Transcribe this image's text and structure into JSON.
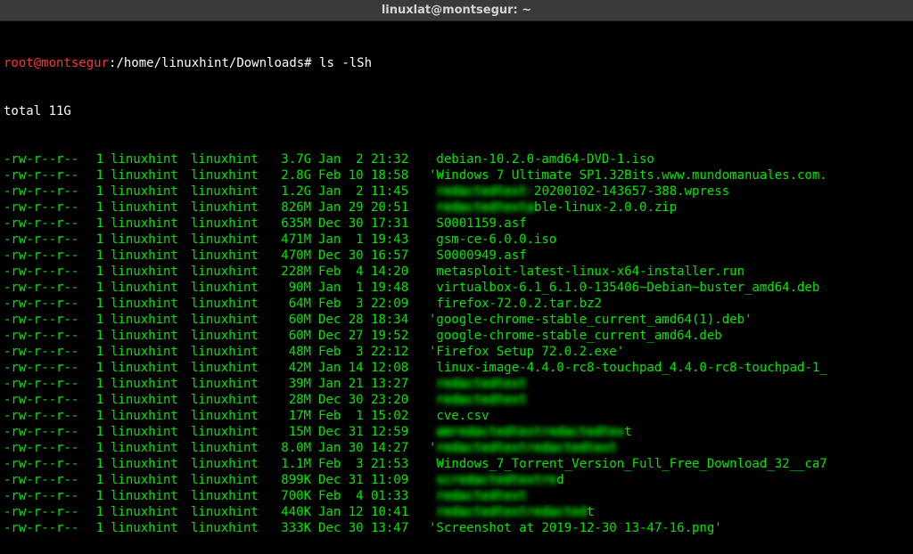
{
  "titlebar": "linuxlat@montsegur: ~",
  "prompt": {
    "user": "root",
    "host": "montsegur",
    "path": "/home/linuxhint/Downloads",
    "hash": "#",
    "command": "ls -lSh"
  },
  "total": "total 11G",
  "rows": [
    {
      "perms": "-rw-r--r--",
      "links": "1",
      "owner": "linuxhint",
      "group": "linuxhint",
      "size": "3.7G",
      "date": "Jan  2 21:32",
      "name": " debian-10.2.0-amd64-DVD-1.iso"
    },
    {
      "perms": "-rw-r--r--",
      "links": "1",
      "owner": "linuxhint",
      "group": "linuxhint",
      "size": "2.8G",
      "date": "Feb 10 18:58",
      "name": "'Windows 7 Ultimate SP1.32Bits.www.mundomanuales.com."
    },
    {
      "perms": "-rw-r--r--",
      "links": "1",
      "owner": "linuxhint",
      "group": "linuxhint",
      "size": "1.2G",
      "date": "Jan  2 11:45",
      "name": " redactedtext-20200102-143657-388.wpress",
      "redact_len": 13
    },
    {
      "perms": "-rw-r--r--",
      "links": "1",
      "owner": "linuxhint",
      "group": "linuxhint",
      "size": "826M",
      "date": "Jan 29 20:51",
      "name": " redactedtextable-linux-2.0.0.zip",
      "redact_len": 13
    },
    {
      "perms": "-rw-r--r--",
      "links": "1",
      "owner": "linuxhint",
      "group": "linuxhint",
      "size": "635M",
      "date": "Dec 30 17:31",
      "name": " S0001159.asf"
    },
    {
      "perms": "-rw-r--r--",
      "links": "1",
      "owner": "linuxhint",
      "group": "linuxhint",
      "size": "471M",
      "date": "Jan  1 19:43",
      "name": " gsm-ce-6.0.0.iso"
    },
    {
      "perms": "-rw-r--r--",
      "links": "1",
      "owner": "linuxhint",
      "group": "linuxhint",
      "size": "470M",
      "date": "Dec 30 16:57",
      "name": " S0000949.asf"
    },
    {
      "perms": "-rw-r--r--",
      "links": "1",
      "owner": "linuxhint",
      "group": "linuxhint",
      "size": "228M",
      "date": "Feb  4 14:20",
      "name": " metasploit-latest-linux-x64-installer.run"
    },
    {
      "perms": "-rw-r--r--",
      "links": "1",
      "owner": "linuxhint",
      "group": "linuxhint",
      "size": "90M",
      "date": "Jan  1 19:48",
      "name": " virtualbox-6.1_6.1.0-135406~Debian~buster_amd64.deb"
    },
    {
      "perms": "-rw-r--r--",
      "links": "1",
      "owner": "linuxhint",
      "group": "linuxhint",
      "size": "64M",
      "date": "Feb  3 22:09",
      "name": " firefox-72.0.2.tar.bz2"
    },
    {
      "perms": "-rw-r--r--",
      "links": "1",
      "owner": "linuxhint",
      "group": "linuxhint",
      "size": "60M",
      "date": "Dec 28 18:34",
      "name": "'google-chrome-stable_current_amd64(1).deb'"
    },
    {
      "perms": "-rw-r--r--",
      "links": "1",
      "owner": "linuxhint",
      "group": "linuxhint",
      "size": "60M",
      "date": "Dec 27 19:52",
      "name": " google-chrome-stable_current_amd64.deb"
    },
    {
      "perms": "-rw-r--r--",
      "links": "1",
      "owner": "linuxhint",
      "group": "linuxhint",
      "size": "48M",
      "date": "Feb  3 22:12",
      "name": "'Firefox Setup 72.0.2.exe'"
    },
    {
      "perms": "-rw-r--r--",
      "links": "1",
      "owner": "linuxhint",
      "group": "linuxhint",
      "size": "42M",
      "date": "Jan 14 12:08",
      "name": " linux-image-4.4.0-rc8-touchpad_4.4.0-rc8-touchpad-1_"
    },
    {
      "perms": "-rw-r--r--",
      "links": "1",
      "owner": "linuxhint",
      "group": "linuxhint",
      "size": "39M",
      "date": "Jan 21 13:27",
      "name": " redactedtext",
      "redact_len": 12
    },
    {
      "perms": "-rw-r--r--",
      "links": "1",
      "owner": "linuxhint",
      "group": "linuxhint",
      "size": "28M",
      "date": "Dec 30 23:20",
      "name": " redactedtext",
      "redact_len": 12
    },
    {
      "perms": "-rw-r--r--",
      "links": "1",
      "owner": "linuxhint",
      "group": "linuxhint",
      "size": "17M",
      "date": "Feb  1 15:02",
      "name": " cve.csv"
    },
    {
      "perms": "-rw-r--r--",
      "links": "1",
      "owner": "linuxhint",
      "group": "linuxhint",
      "size": "15M",
      "date": "Dec 31 12:59",
      "name": " amredactedtextredactedtext",
      "redact_len": 25
    },
    {
      "perms": "-rw-r--r--",
      "links": "1",
      "owner": "linuxhint",
      "group": "linuxhint",
      "size": "8.0M",
      "date": "Jan 30 14:27",
      "name": "'redactedtextredactedtext",
      "redact_len": 24
    },
    {
      "perms": "-rw-r--r--",
      "links": "1",
      "owner": "linuxhint",
      "group": "linuxhint",
      "size": "1.1M",
      "date": "Feb  3 21:53",
      "name": " Windows_7_Torrent_Version_Full_Free_Download_32__ca7"
    },
    {
      "perms": "-rw-r--r--",
      "links": "1",
      "owner": "linuxhint",
      "group": "linuxhint",
      "size": "899K",
      "date": "Dec 31 11:09",
      "name": " scredactedtextred",
      "redact_len": 16
    },
    {
      "perms": "-rw-r--r--",
      "links": "1",
      "owner": "linuxhint",
      "group": "linuxhint",
      "size": "700K",
      "date": "Feb  4 01:33",
      "name": " redactedtext",
      "redact_len": 12
    },
    {
      "perms": "-rw-r--r--",
      "links": "1",
      "owner": "linuxhint",
      "group": "linuxhint",
      "size": "440K",
      "date": "Jan 12 10:41",
      "name": " redactedtextredactedt",
      "redact_len": 20
    },
    {
      "perms": "-rw-r--r--",
      "links": "1",
      "owner": "linuxhint",
      "group": "linuxhint",
      "size": "333K",
      "date": "Dec 30 13:47",
      "name": "'Screenshot at 2019-12-30 13-47-16.png'"
    }
  ]
}
